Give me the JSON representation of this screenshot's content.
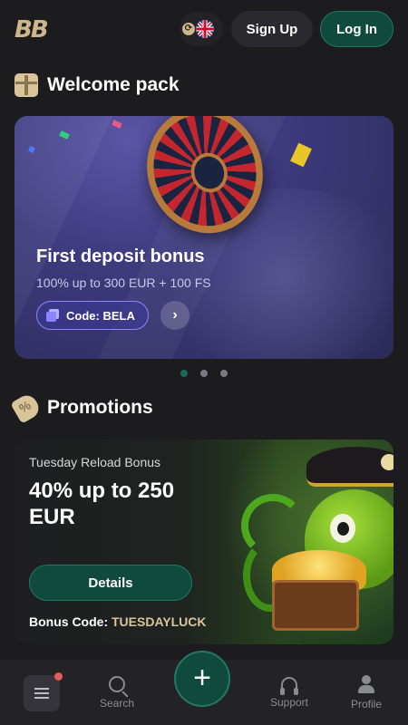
{
  "header": {
    "logo_text": "BB",
    "language": "English (UK)",
    "signup_label": "Sign Up",
    "login_label": "Log In"
  },
  "welcome": {
    "section_title": "Welcome pack",
    "card": {
      "title": "First deposit bonus",
      "subtitle": "100% up to 300 EUR + 100 FS",
      "code_label": "Code: BELA"
    },
    "carousel_pages": 3,
    "carousel_active": 1
  },
  "promotions": {
    "section_title": "Promotions",
    "card": {
      "label": "Tuesday Reload Bonus",
      "title": "40% up to 250 EUR",
      "button_label": "Details",
      "bonus_code_prefix": "Bonus Code:",
      "bonus_code_value": "TUESDAYLUCK"
    }
  },
  "bottom_nav": {
    "menu_has_notification": true,
    "search_label": "Search",
    "support_label": "Support",
    "profile_label": "Profile"
  },
  "colors": {
    "background": "#1c1c1f",
    "accent_green": "#0f4a3c",
    "gold": "#cdb68a",
    "promo_purple": "#8a86ff"
  }
}
